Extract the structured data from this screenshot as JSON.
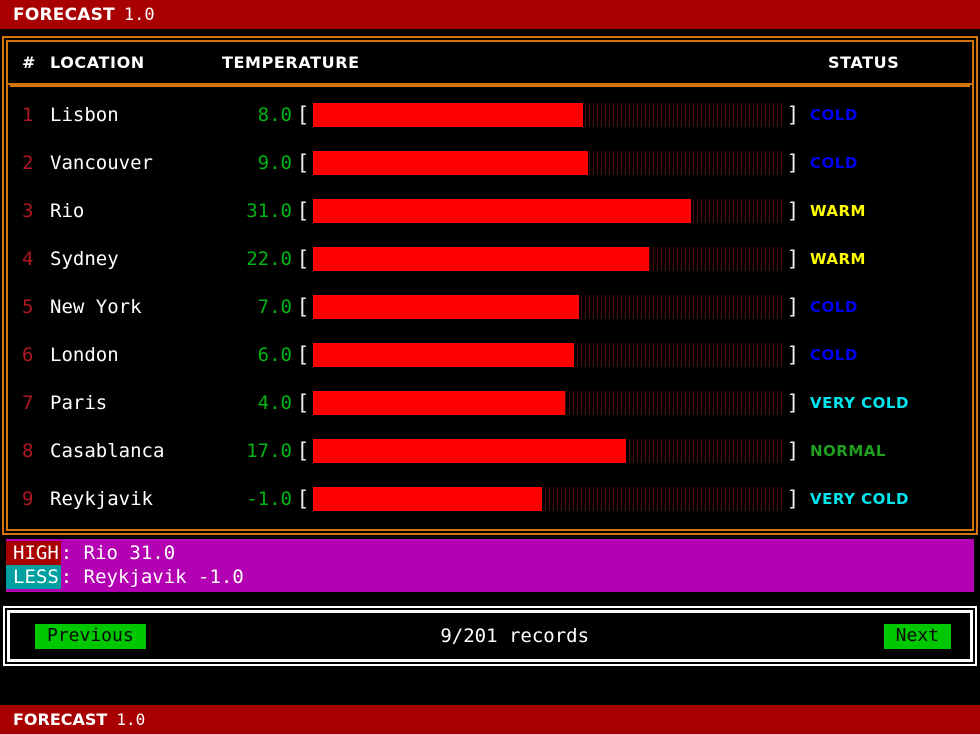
{
  "titlebar": {
    "app_name": "FORECAST",
    "version": "1.0"
  },
  "statusbar": {
    "app_name": "FORECAST",
    "version": "1.0"
  },
  "table": {
    "columns": {
      "number": "#",
      "location": "LOCATION",
      "temperature": "TEMPERATURE",
      "status": "STATUS"
    },
    "bracket_open": "[",
    "bracket_close": "]",
    "rows": [
      {
        "num": "1",
        "location": "Lisbon",
        "temp": "8.0",
        "temp_value": 8.0,
        "bar_pct": 57.4,
        "status": "COLD",
        "status_class": "st-cold"
      },
      {
        "num": "2",
        "location": "Vancouver",
        "temp": "9.0",
        "temp_value": 9.0,
        "bar_pct": 58.6,
        "status": "COLD",
        "status_class": "st-cold"
      },
      {
        "num": "3",
        "location": "Rio",
        "temp": "31.0",
        "temp_value": 31.0,
        "bar_pct": 80.5,
        "status": "WARM",
        "status_class": "st-warm"
      },
      {
        "num": "4",
        "location": "Sydney",
        "temp": "22.0",
        "temp_value": 22.0,
        "bar_pct": 71.5,
        "status": "WARM",
        "status_class": "st-warm"
      },
      {
        "num": "5",
        "location": "New York",
        "temp": "7.0",
        "temp_value": 7.0,
        "bar_pct": 56.5,
        "status": "COLD",
        "status_class": "st-cold"
      },
      {
        "num": "6",
        "location": "London",
        "temp": "6.0",
        "temp_value": 6.0,
        "bar_pct": 55.5,
        "status": "COLD",
        "status_class": "st-cold"
      },
      {
        "num": "7",
        "location": "Paris",
        "temp": "4.0",
        "temp_value": 4.0,
        "bar_pct": 53.7,
        "status": "VERY COLD",
        "status_class": "st-verycold"
      },
      {
        "num": "8",
        "location": "Casablanca",
        "temp": "17.0",
        "temp_value": 17.0,
        "bar_pct": 66.7,
        "status": "NORMAL",
        "status_class": "st-normal"
      },
      {
        "num": "9",
        "location": "Reykjavik",
        "temp": "-1.0",
        "temp_value": -1.0,
        "bar_pct": 48.8,
        "status": "VERY COLD",
        "status_class": "st-verycold"
      }
    ]
  },
  "summary": {
    "high_tag": "HIGH",
    "high_text": ": Rio 31.0",
    "less_tag": "LESS",
    "less_text": ": Reykjavik -1.0"
  },
  "pagination": {
    "previous_label": "Previous",
    "next_label": "Next",
    "records": "9/201 records"
  },
  "colors": {
    "title_bg": "#a80000",
    "panel_border": "#d2760a",
    "bar_fill": "#ff0000",
    "bar_track": "#4a0a0a",
    "summary_bg": "#b200b2",
    "button_bg": "#00c800",
    "temp_text": "#00b412",
    "row_num": "#b01722",
    "cold": "#0000ee",
    "warm": "#ffff00",
    "very_cold": "#00e5ee",
    "normal": "#1ea01e"
  }
}
